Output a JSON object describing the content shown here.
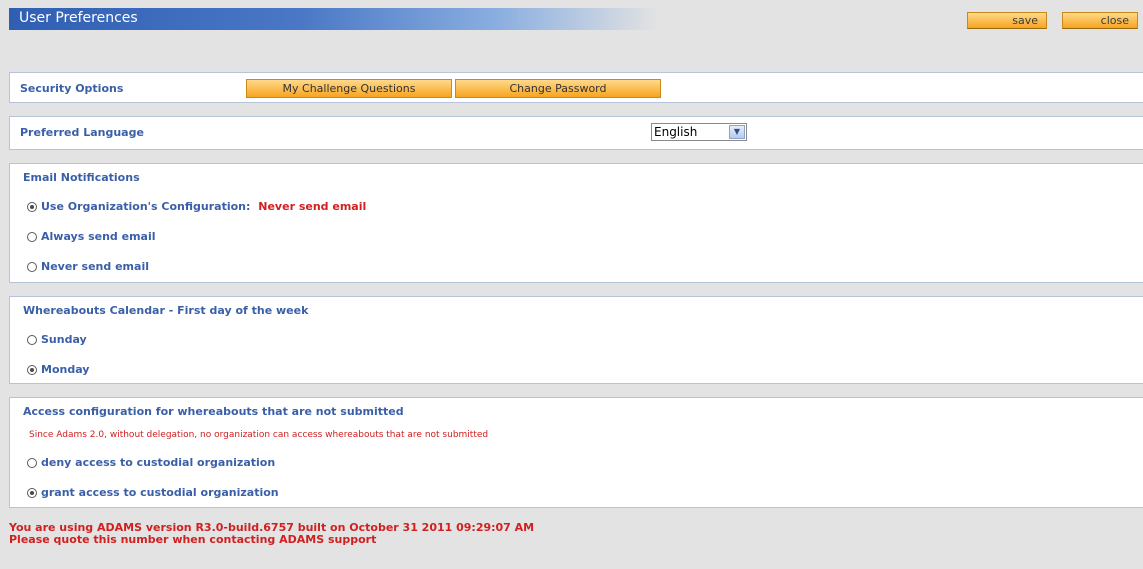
{
  "header": {
    "title": "User Preferences",
    "save_label": "save",
    "close_label": "close"
  },
  "security": {
    "label": "Security Options",
    "challenge_label": "My Challenge Questions",
    "password_label": "Change Password"
  },
  "language": {
    "label": "Preferred Language",
    "selected": "English"
  },
  "email": {
    "label": "Email Notifications",
    "options": [
      {
        "label": "Use Organization's Configuration:",
        "checked": true
      },
      {
        "label": "Always send email",
        "checked": false
      },
      {
        "label": "Never send email",
        "checked": false
      }
    ],
    "org_value": "Never send email"
  },
  "calendar": {
    "label": "Whereabouts Calendar - First day of the week",
    "options": [
      {
        "label": "Sunday",
        "checked": false
      },
      {
        "label": "Monday",
        "checked": true
      }
    ]
  },
  "access": {
    "label": "Access configuration for whereabouts that are not submitted",
    "note": "Since Adams 2.0, without delegation, no organization can access whereabouts that are not submitted",
    "options": [
      {
        "label": "deny access to custodial organization",
        "checked": false
      },
      {
        "label": "grant access to custodial organization",
        "checked": true
      }
    ]
  },
  "footer": {
    "line1": "You are using ADAMS version R3.0-build.6757 built on October 31 2011 09:29:07 AM",
    "line2": "Please quote this number when contacting ADAMS support"
  },
  "colors": {
    "accent": "#3a5fa8",
    "warning": "#d02020",
    "button": "#f7a41f"
  }
}
